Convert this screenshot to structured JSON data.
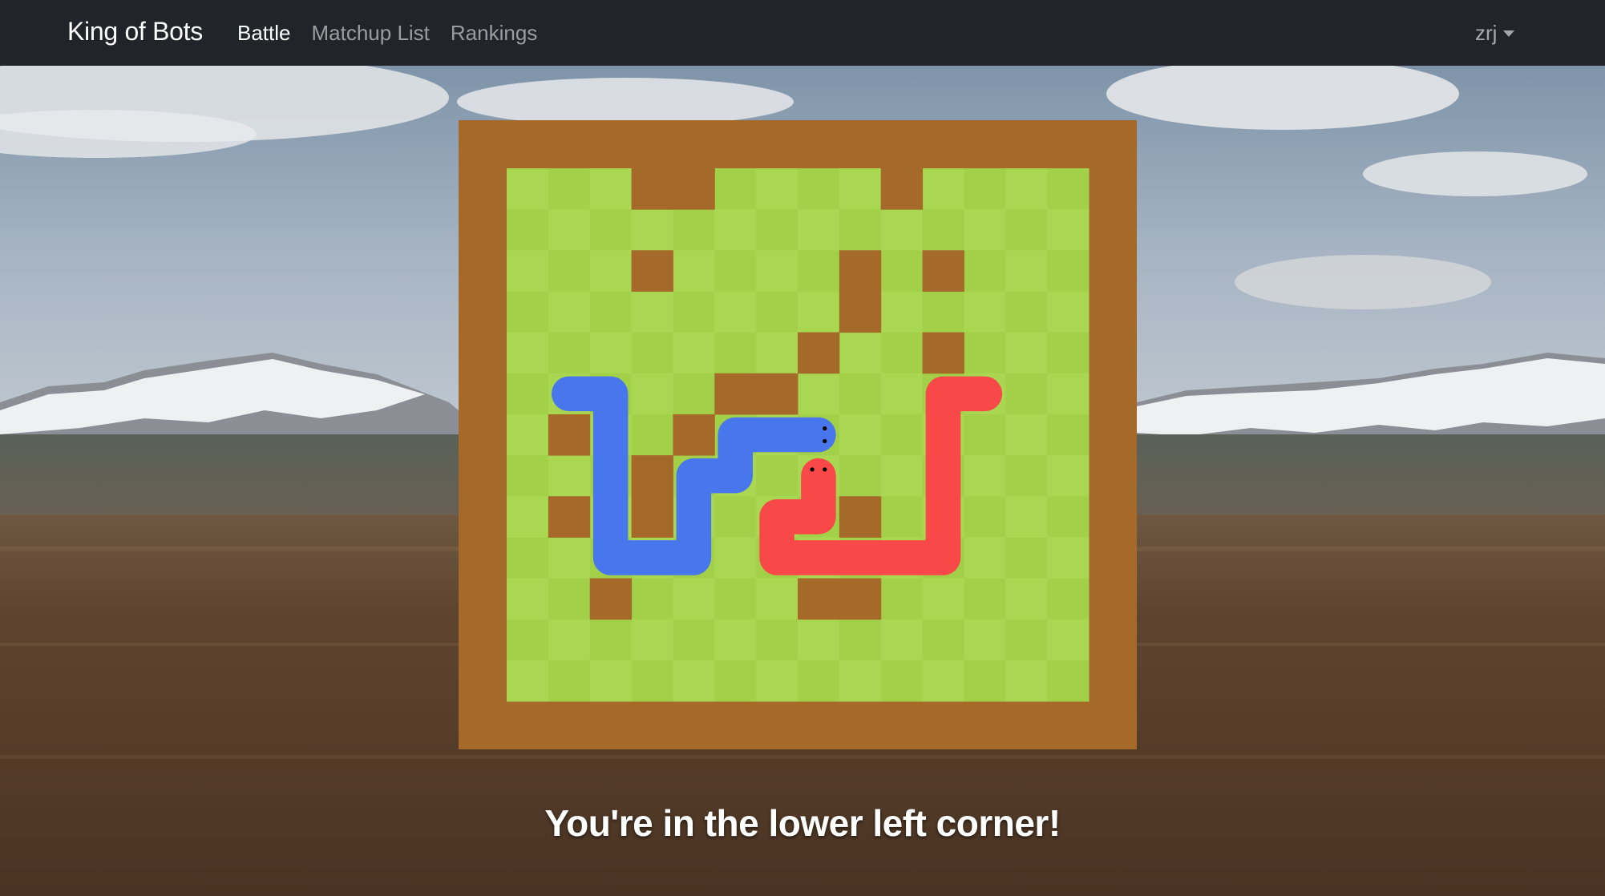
{
  "navbar": {
    "brand": "King of Bots",
    "links": [
      {
        "label": "Battle",
        "active": true
      },
      {
        "label": "Matchup List",
        "active": false
      },
      {
        "label": "Rankings",
        "active": false
      }
    ],
    "user": "zrj"
  },
  "game": {
    "grid": {
      "rows": 13,
      "cols": 14
    },
    "colors": {
      "wall": "#A5692A",
      "grass_light": "#AAD751",
      "grass_dark": "#A2D149",
      "snake_blue": "#4876EC",
      "snake_red": "#F94848"
    },
    "walls": [
      [
        3,
        0
      ],
      [
        4,
        0
      ],
      [
        9,
        0
      ],
      [
        3,
        2
      ],
      [
        8,
        2
      ],
      [
        10,
        2
      ],
      [
        8,
        3
      ],
      [
        7,
        4
      ],
      [
        10,
        4
      ],
      [
        5,
        5
      ],
      [
        6,
        5
      ],
      [
        1,
        6
      ],
      [
        4,
        6
      ],
      [
        3,
        7
      ],
      [
        1,
        8
      ],
      [
        3,
        8
      ],
      [
        8,
        8
      ],
      [
        2,
        10
      ],
      [
        7,
        10
      ],
      [
        8,
        10
      ]
    ],
    "snakes": [
      {
        "name": "blue",
        "cells": [
          [
            7,
            6
          ],
          [
            6,
            6
          ],
          [
            5,
            6
          ],
          [
            5,
            7
          ],
          [
            4,
            7
          ],
          [
            4,
            8
          ],
          [
            4,
            9
          ],
          [
            3,
            9
          ],
          [
            2,
            9
          ],
          [
            2,
            8
          ],
          [
            2,
            7
          ],
          [
            2,
            6
          ],
          [
            2,
            5
          ],
          [
            1,
            5
          ]
        ]
      },
      {
        "name": "red",
        "cells": [
          [
            7,
            7
          ],
          [
            7,
            8
          ],
          [
            6,
            8
          ],
          [
            6,
            9
          ],
          [
            7,
            9
          ],
          [
            8,
            9
          ],
          [
            9,
            9
          ],
          [
            10,
            9
          ],
          [
            10,
            8
          ],
          [
            10,
            7
          ],
          [
            10,
            6
          ],
          [
            10,
            5
          ],
          [
            11,
            5
          ]
        ]
      }
    ],
    "result_message": "You're in the lower left corner!"
  }
}
